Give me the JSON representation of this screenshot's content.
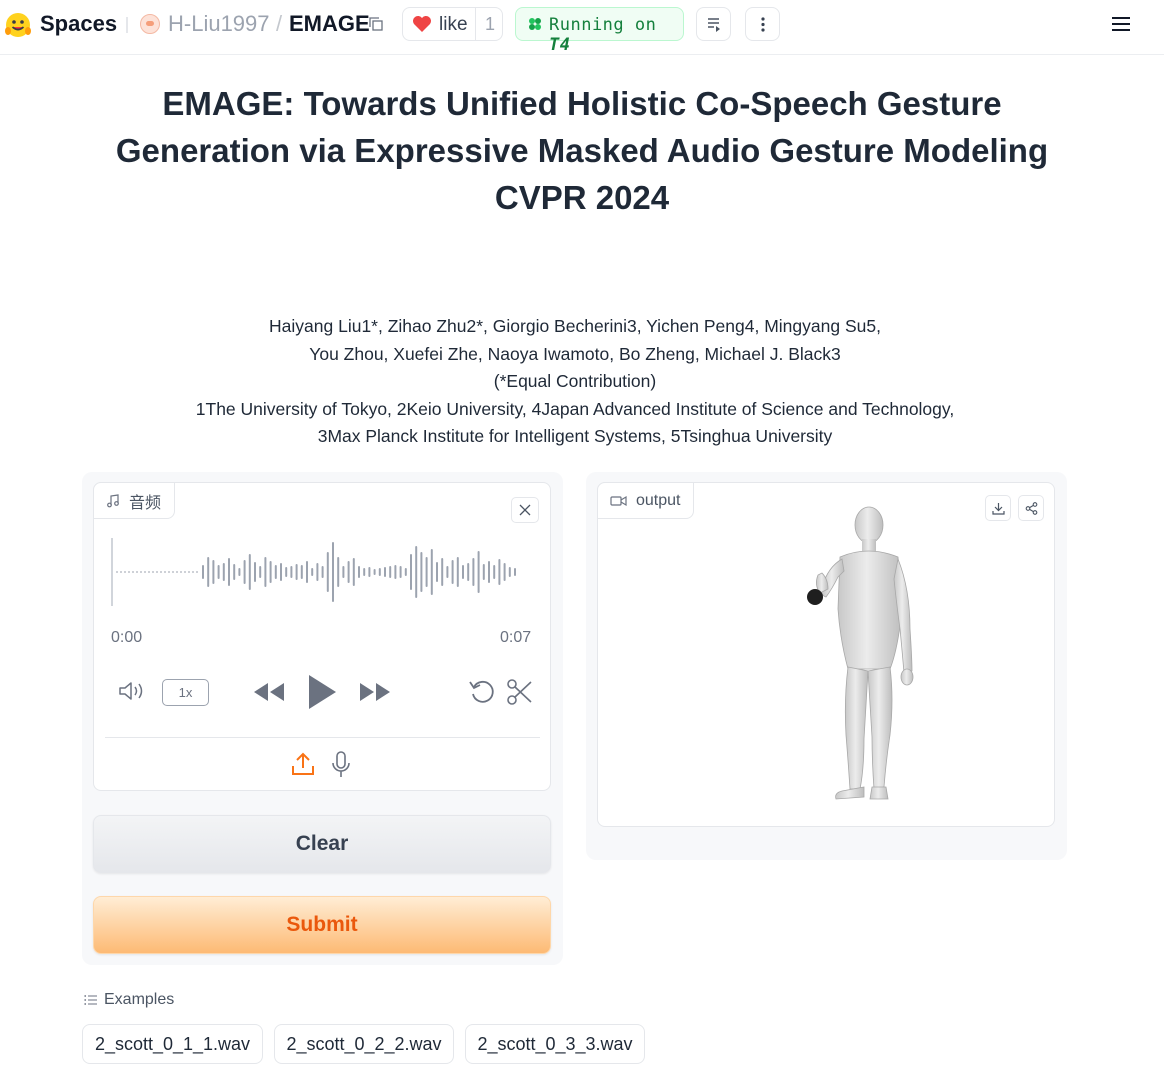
{
  "topbar": {
    "brand": "Spaces",
    "owner": "H-Liu1997",
    "slash": "/",
    "repo": "EMAGE",
    "like_label": "like",
    "like_count": "1",
    "status_prefix": "Running on ",
    "status_hardware": "T4",
    "status_color": "#15803d",
    "icons": [
      "hugging-face-logo",
      "copy-icon",
      "heart-icon",
      "status-icon",
      "list-icon",
      "more-vertical-icon",
      "menu-icon"
    ]
  },
  "title": {
    "line1": "EMAGE: Towards Unified Holistic Co-Speech Gesture",
    "line2": "Generation via Expressive Masked Audio Gesture Modeling",
    "line3": "CVPR 2024"
  },
  "authors": {
    "line1": "Haiyang Liu1*, Zihao Zhu2*, Giorgio Becherini3, Yichen Peng4, Mingyang Su5,",
    "line2": "You Zhou, Xuefei Zhe, Naoya Iwamoto, Bo Zheng, Michael J. Black3",
    "line3": "(*Equal Contribution)",
    "line4": "1The University of Tokyo, 2Keio University, 4Japan Advanced Institute of Science and Technology,",
    "line5": "3Max Planck Institute for Intelligent Systems, 5Tsinghua University"
  },
  "audio": {
    "label": "音频",
    "time_start": "0:00",
    "time_end": "0:07",
    "speed": "1x",
    "icons": [
      "music-note-icon",
      "close-icon",
      "volume-icon",
      "rewind-icon",
      "play-icon",
      "fast-forward-icon",
      "undo-icon",
      "scissors-icon",
      "upload-icon",
      "microphone-icon"
    ]
  },
  "buttons": {
    "clear": "Clear",
    "submit": "Submit",
    "submit_color": "#ea580c"
  },
  "output": {
    "label": "output",
    "icons": [
      "video-icon",
      "download-icon",
      "share-icon"
    ]
  },
  "examples": {
    "label": "Examples",
    "items": [
      "2_scott_0_1_1.wav",
      "2_scott_0_2_2.wav",
      "2_scott_0_3_3.wav"
    ]
  }
}
